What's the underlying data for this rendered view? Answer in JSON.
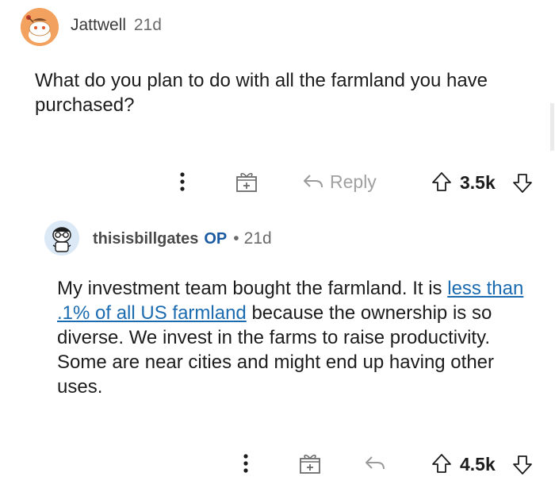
{
  "comment1": {
    "username": "Jattwell",
    "age": "21d",
    "text": "What do you plan to do with all the farmland you have purchased?",
    "actions": {
      "reply_label": "Reply",
      "score": "3.5k"
    }
  },
  "comment2": {
    "username": "thisisbillgates",
    "op_badge": "OP",
    "separator": "•",
    "age": "21d",
    "text_part1": "My investment team bought the farmland. It is ",
    "link_text": "less than .1% of all US farmland",
    "text_part2": " because the ownership is so diverse. We invest in the farms to raise productivity. Some are near cities and might end up having other uses.",
    "actions": {
      "score": "4.5k"
    }
  },
  "colors": {
    "link": "#1a6bb0",
    "op_badge": "#1a5aa0",
    "avatar1_bg": "#f2a25e",
    "avatar2_bg": "#dbe9f6",
    "muted": "#878a8c"
  }
}
